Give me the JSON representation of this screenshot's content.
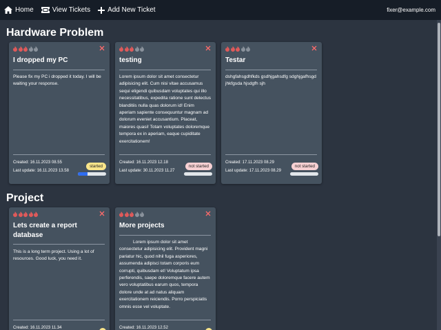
{
  "nav": {
    "home_label": "Home",
    "view_tickets_label": "View Tickets",
    "add_ticket_label": "Add New Ticket",
    "user_email": "fixer@example.com"
  },
  "colors": {
    "navbar": "#161d27",
    "background": "#2c3440",
    "card": "#45525f",
    "flame_active": "#e05a5a",
    "flame_inactive": "#8a929c",
    "close": "#ff6b6b",
    "badge_started": "#f9e58a",
    "badge_not_started": "#f7d0d3",
    "progress_fill": "#2f6df0"
  },
  "sections": [
    {
      "title": "Hardware Problem",
      "tickets": [
        {
          "priority": 3,
          "title": "I dropped my PC",
          "description": "Please fix my PC i dropped it today. I will be waiting your response.",
          "created": "Created: 16.11.2023 08.55",
          "last_update": "Last update: 16.11.2023 13.58",
          "status": "started",
          "progress": 0.35
        },
        {
          "priority": 3,
          "title": "testing",
          "description": "Lorem ipsum dolor sit amet consectetur adipisicing elit. Cum nisi vitae accusamus sequi eligendi quibusdam voluptates qui illo necessitatibus, expedita ratione sunt delectus blanditiis nulla quas dolorum id! Enim aperiam sapiente consequuntur magnam ad dolorum eveniet accusantium. Placeat, maiores quasi! Totam voluptates doloremque tempora ex in aperiam, eaque cupiditate exercitationem!",
          "created": "Created: 16.11.2023 12.18",
          "last_update": "Last update: 30.11.2023 11.27",
          "status": "not started",
          "progress": 0
        },
        {
          "priority": 3,
          "title": "Testar",
          "description": "dshgfahsgdhfkds gsdhjgahsdfg sdghjgafhsgd jhkfgsda hjsdgfh sjh",
          "created": "Created: 17.11.2023 08.29",
          "last_update": "Last update: 17.11.2023 08.29",
          "status": "not started",
          "progress": 0
        }
      ]
    },
    {
      "title": "Project",
      "tickets": [
        {
          "priority": 5,
          "title": "Lets create a report database",
          "description": "This is a long term project. Using a lot of resources. Good luck, you need it.",
          "created": "Created: 16.11.2023 11.34"
        },
        {
          "priority": 3,
          "title": "More projects",
          "description": "Lorem ipsum dolor sit amet consectetur adipisicing elit. Provident magni pariatur hic, quod nihil fuga asperiores, assumenda adipisci totam corporis eum corrupti, quibusdam et! Voluptatum ipsa perferendis, saepe doloremque facere autem vero voluptatibus earum quos, tempora dolore unde at ad natus aliquam exercitationem reiciendis. Porro perspiciatis omnis esse vel voluptate.",
          "created": "Created: 16.11.2023 12.52"
        }
      ]
    }
  ]
}
